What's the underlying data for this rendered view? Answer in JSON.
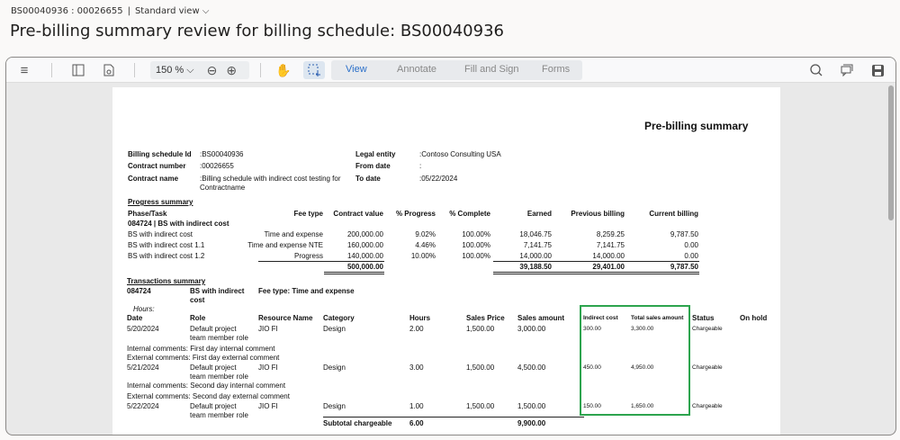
{
  "breadcrumb": {
    "record": "BS00040936 : 00026655",
    "view": "Standard view"
  },
  "page_title": "Pre-billing summary review for billing schedule: BS00040936",
  "toolbar": {
    "zoom": "150 %",
    "modes": [
      "View",
      "Annotate",
      "Fill and Sign",
      "Forms"
    ]
  },
  "report": {
    "title": "Pre-billing summary",
    "header": [
      {
        "label": "Billing schedule Id",
        "value": ":BS00040936"
      },
      {
        "label": "Contract number",
        "value": ":00026655"
      },
      {
        "label": "Contract name",
        "value": ":Billing schedule with indirect cost testing for Contractname"
      },
      {
        "label": "Legal entity",
        "value": ":Contoso Consulting USA"
      },
      {
        "label": "From date",
        "value": ":"
      },
      {
        "label": "To date",
        "value": ":05/22/2024"
      }
    ],
    "progress": {
      "title": "Progress summary",
      "columns": [
        "Phase/Task",
        "Fee type",
        "Contract value",
        "% Progress",
        "% Complete",
        "Earned",
        "Previous billing",
        "Current billing"
      ],
      "group": "084724 | BS with indirect cost",
      "rows": [
        [
          "BS with indirect cost",
          "Time and expense",
          "200,000.00",
          "9.02%",
          "100.00%",
          "18,046.75",
          "8,259.25",
          "9,787.50"
        ],
        [
          "BS with indirect cost 1.1",
          "Time and expense NTE",
          "160,000.00",
          "4.46%",
          "100.00%",
          "7,141.75",
          "7,141.75",
          "0.00"
        ],
        [
          "BS with indirect cost 1.2",
          "Progress",
          "140,000.00",
          "10.00%",
          "100.00%",
          "14,000.00",
          "14,000.00",
          "0.00"
        ]
      ],
      "totals": {
        "contract_value": "500,000.00",
        "earned": "39,188.50",
        "previous": "29,401.00",
        "current": "9,787.50"
      }
    },
    "transactions": {
      "title": "Transactions summary",
      "group_id": "084724",
      "group_name": "BS with indirect cost",
      "fee_type": "Fee type: Time and expense",
      "hours_label": "Hours:",
      "columns": [
        "Date",
        "Role",
        "Resource Name",
        "Category",
        "Hours",
        "Sales Price",
        "Sales amount",
        "Indirect cost",
        "Total sales amount",
        "Status",
        "On hold"
      ],
      "rows": [
        {
          "cells": [
            "5/20/2024",
            "Default project team member role",
            "JIO FI",
            "Design",
            "2.00",
            "1,500.00",
            "3,000.00",
            "300.00",
            "3,300.00",
            "Chargeable",
            ""
          ],
          "internal": "Internal comments: First day internal comment",
          "external": "External comments: First day external comment"
        },
        {
          "cells": [
            "5/21/2024",
            "Default project team member role",
            "JIO FI",
            "Design",
            "3.00",
            "1,500.00",
            "4,500.00",
            "450.00",
            "4,950.00",
            "Chargeable",
            ""
          ],
          "internal": "Internal comments: Second day internal comment",
          "external": "External comments: Second day external comment"
        },
        {
          "cells": [
            "5/22/2024",
            "Default project team member role",
            "JIO FI",
            "Design",
            "1.00",
            "1,500.00",
            "1,500.00",
            "150.00",
            "1,650.00",
            "Chargeable",
            ""
          ]
        }
      ],
      "subtotal": {
        "label": "Subtotal chargeable",
        "hours": "6.00",
        "sales_amount": "9,900.00"
      }
    }
  },
  "colors": {
    "highlight": "#2da44e",
    "active_mode": "#2a6fc9"
  }
}
